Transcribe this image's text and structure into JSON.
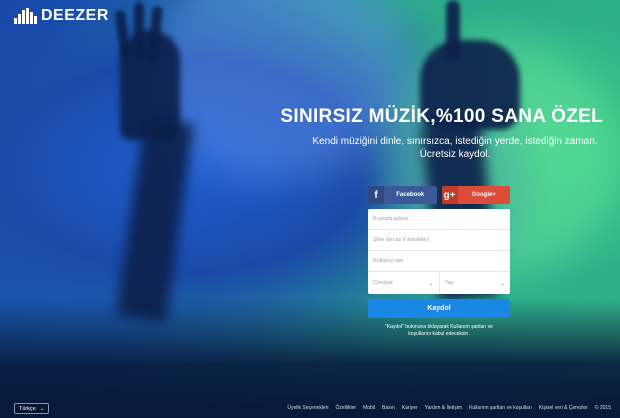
{
  "brand": {
    "name": "DEEZER",
    "icon": "equalizer-bars-icon"
  },
  "hero": {
    "headline": "SINIRSIZ MÜZİK,%100 SANA ÖZEL",
    "subline_1": "Kendi müziğini dinle, sınırsızca, istediğin yerde, istediğin zaman.",
    "subline_2": "Ücretsiz kaydol."
  },
  "signup": {
    "facebook_label": "Facebook",
    "google_label": "Google+",
    "email_placeholder": "E-posta adresi",
    "password_placeholder": "Şifre (en az 6 karakter)",
    "username_placeholder": "Kullanıcı adı",
    "gender_placeholder": "Cinsiyet",
    "age_placeholder": "Yaş",
    "submit_label": "Kaydol",
    "terms_line_1": "\"Kaydol\" butonuna tıklayarak Kullanım şartları ve",
    "terms_line_2": "koşullarını kabul edeceksin."
  },
  "language": {
    "selected": "Türkçe"
  },
  "footer": {
    "links": [
      "Üyelik Seçenekleri",
      "Özellikler",
      "Mobil",
      "Basın",
      "Kariyer",
      "Yardım & İletişim",
      "Kullanım şartları ve koşulları",
      "Kişisel veri & Çerezler"
    ],
    "copyright": "© 2015"
  },
  "colors": {
    "facebook": "#3b5998",
    "google": "#dd4b39",
    "submit": "#1b87e5"
  }
}
